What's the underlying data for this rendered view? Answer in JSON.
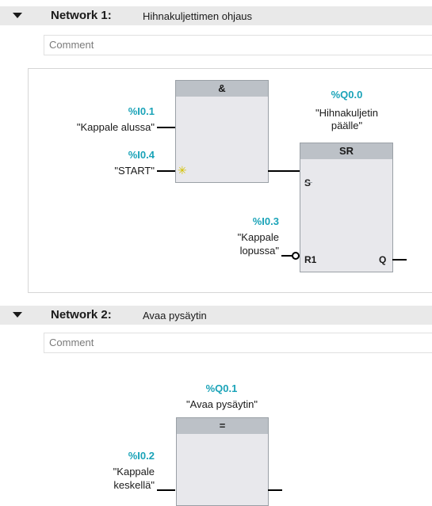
{
  "network1": {
    "label": "Network 1:",
    "title": "Hihnakuljettimen ohjaus",
    "comment": "Comment",
    "and_block": {
      "symbol": "&"
    },
    "inputs": [
      {
        "address": "%I0.1",
        "tag": "\"Kappale alussa\""
      },
      {
        "address": "%I0.4",
        "tag": "\"START\""
      }
    ],
    "sr_block": {
      "symbol": "SR",
      "output_address": "%Q0.0",
      "output_tag_line1": "\"Hihnakuljetin",
      "output_tag_line2": "päälle\"",
      "pin_s": "S",
      "pin_r1": "R1",
      "pin_q": "Q",
      "reset_address": "%I0.3",
      "reset_tag_line1": "\"Kappale",
      "reset_tag_line2": "lopussa\""
    }
  },
  "network2": {
    "label": "Network 2:",
    "title": "Avaa pysäytin",
    "comment": "Comment",
    "assign_block": {
      "symbol": "=",
      "output_address": "%Q0.1",
      "output_tag": "\"Avaa pysäytin\""
    },
    "input": {
      "address": "%I0.2",
      "tag_line1": "\"Kappale",
      "tag_line2": "keskellä\""
    }
  },
  "colors": {
    "address": "#1aa3b8",
    "block_header": "#bcc1c7",
    "block_body": "#e8e8ec",
    "header_bar": "#e9e9e9"
  },
  "icons": [
    "collapse-triangle-icon",
    "negation-circle-icon",
    "empty-input-star-icon"
  ]
}
